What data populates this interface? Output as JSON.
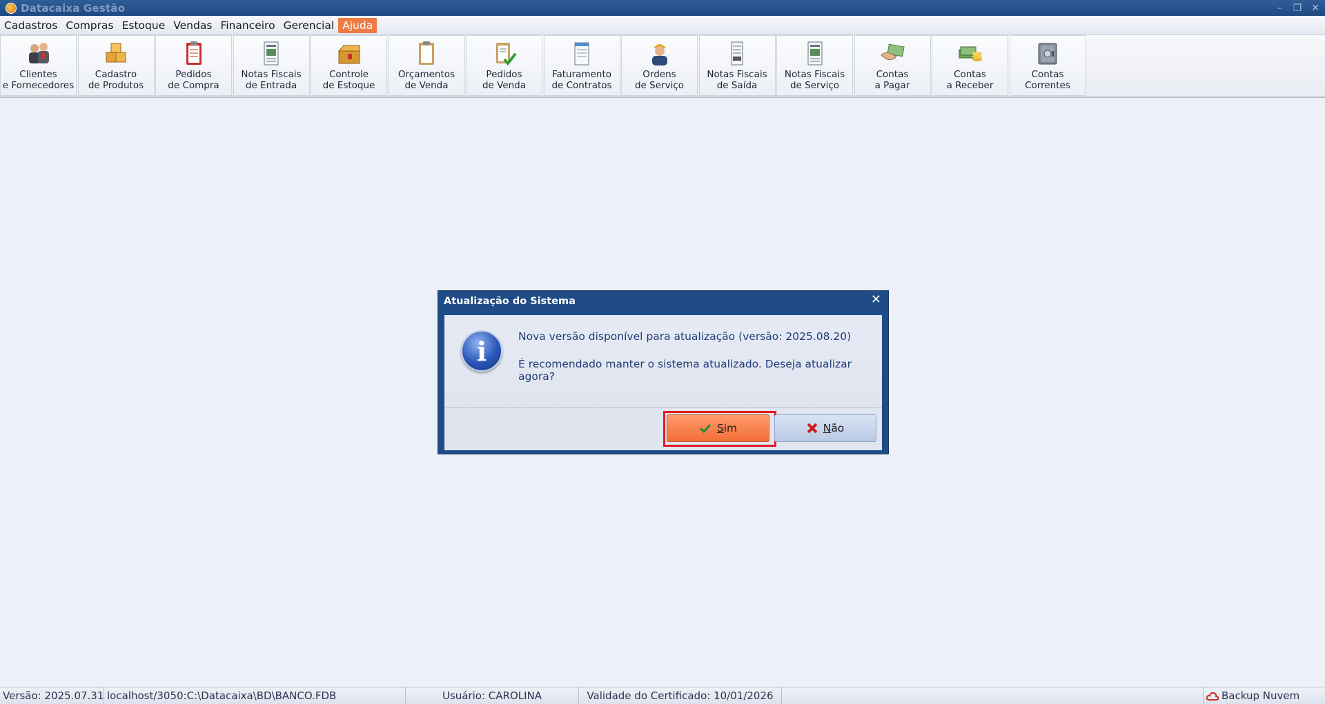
{
  "window": {
    "title": "Datacaixa Gestão",
    "controls": [
      "–",
      "❐",
      "✕"
    ]
  },
  "menu": [
    {
      "label": "Cadastros"
    },
    {
      "label": "Compras"
    },
    {
      "label": "Estoque"
    },
    {
      "label": "Vendas"
    },
    {
      "label": "Financeiro"
    },
    {
      "label": "Gerencial"
    },
    {
      "label": "Ajuda",
      "active": true
    }
  ],
  "toolbar": [
    {
      "label": "Clientes\ne Fornecedores",
      "icon": "people-icon"
    },
    {
      "label": "Cadastro\nde Produtos",
      "icon": "boxes-icon"
    },
    {
      "label": "Pedidos\nde Compra",
      "icon": "clipboard-red-icon"
    },
    {
      "label": "Notas Fiscais\nde Entrada",
      "icon": "invoice-icon"
    },
    {
      "label": "Controle\nde Estoque",
      "icon": "box-stock-icon"
    },
    {
      "label": "Orçamentos\nde Venda",
      "icon": "clipboard-icon"
    },
    {
      "label": "Pedidos\nde Venda",
      "icon": "clipboard-check-icon"
    },
    {
      "label": "Faturamento\nde Contratos",
      "icon": "document-icon"
    },
    {
      "label": "Ordens\nde Serviço",
      "icon": "worker-icon"
    },
    {
      "label": "Notas Fiscais\nde Saída",
      "icon": "receipt-icon"
    },
    {
      "label": "Notas Fiscais\nde Serviço",
      "icon": "invoice-icon"
    },
    {
      "label": "Contas\na Pagar",
      "icon": "hand-money-icon"
    },
    {
      "label": "Contas\na Receber",
      "icon": "coins-icon"
    },
    {
      "label": "Contas\nCorrentes",
      "icon": "safe-icon"
    }
  ],
  "dialog": {
    "title": "Atualização do Sistema",
    "close": "✕",
    "message1": "Nova versão disponível para atualização (versão: 2025.08.20)",
    "message2": "É recomendado manter o sistema atualizado. Deseja atualizar agora?",
    "yes_prefix": "",
    "yes_accel": "S",
    "yes_rest": "im",
    "no_accel": "N",
    "no_rest": "ão"
  },
  "status": {
    "version": "Versão: 2025.07.31",
    "database": "localhost/3050:C:\\Datacaixa\\BD\\BANCO.FDB",
    "user": "Usuário: CAROLINA",
    "certificate": "Validade do Certificado: 10/01/2026",
    "backup": "Backup Nuvem"
  },
  "colors": {
    "titlebar": "#1e4a82",
    "accent": "#ef7a45",
    "dialog_border": "#1f4c86",
    "highlight": "#e01b24"
  }
}
